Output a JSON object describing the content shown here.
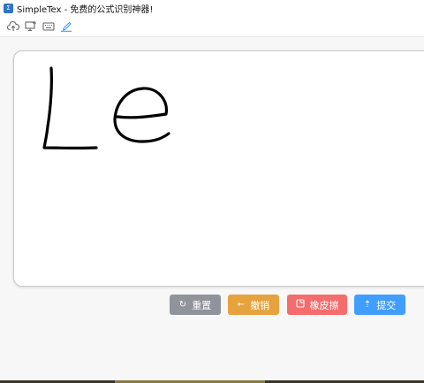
{
  "window": {
    "title": "SimpleTex - 免费的公式识别神器!",
    "app_icon": "Σ"
  },
  "toolbar": {
    "tools": [
      {
        "name": "upload-cloud-icon",
        "active": false
      },
      {
        "name": "screen-capture-icon",
        "active": false
      },
      {
        "name": "keyboard-icon",
        "active": false
      },
      {
        "name": "handwrite-pen-icon",
        "active": true
      }
    ]
  },
  "canvas": {
    "handwritten_text": "Le"
  },
  "buttons": {
    "reset": {
      "label": "重置",
      "icon": "refresh-icon",
      "color": "#909399"
    },
    "undo": {
      "label": "撤销",
      "icon": "arrow-left-icon",
      "color": "#e6a23c"
    },
    "eraser": {
      "label": "橡皮擦",
      "icon": "eraser-icon",
      "color": "#f56c6c"
    },
    "submit": {
      "label": "提交",
      "icon": "upload-icon",
      "color": "#409eff"
    }
  },
  "colors": {
    "active_tool": "#409eff",
    "ink": "#000000"
  }
}
